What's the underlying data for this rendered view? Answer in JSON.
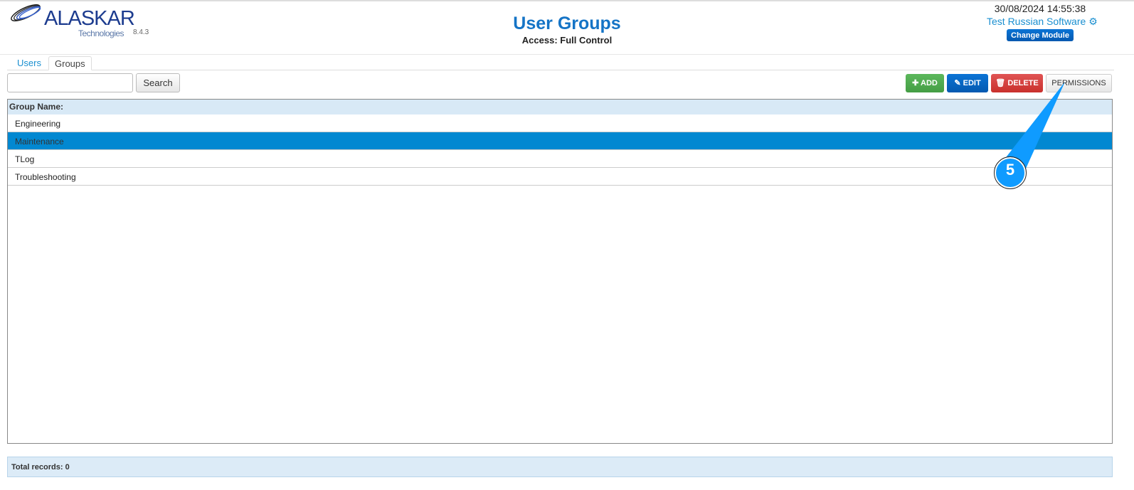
{
  "header": {
    "brand": "ALASKAR",
    "brand_sub": "Technologies",
    "version": "8.4.3",
    "title": "User Groups",
    "access": "Access: Full Control",
    "datetime": "30/08/2024 14:55:38",
    "company": "Test Russian Software",
    "change_module": "Change Module"
  },
  "tabs": [
    {
      "label": "Users"
    },
    {
      "label": "Groups",
      "active": true
    }
  ],
  "toolbar": {
    "search_value": "",
    "search_label": "Search",
    "add": "ADD",
    "edit": "EDIT",
    "delete": "DELETE",
    "permissions": "PERMISSIONS"
  },
  "grid": {
    "header": "Group Name:",
    "rows": [
      "Engineering",
      "Maintenance",
      "TLog",
      "Troubleshooting"
    ],
    "selected": "Maintenance"
  },
  "footer": {
    "total": "Total records: 0"
  },
  "annotation": {
    "number": "5",
    "color": "#0f9bff"
  }
}
